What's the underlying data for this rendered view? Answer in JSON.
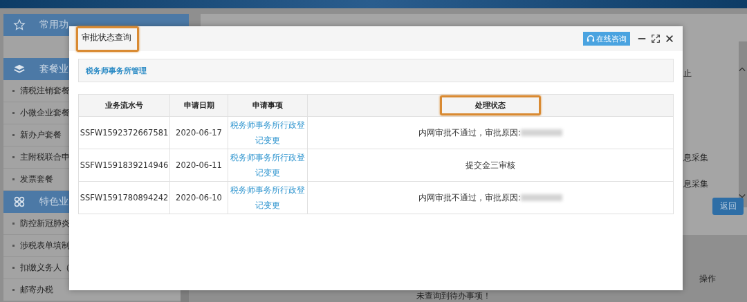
{
  "sidebar": {
    "sections": [
      {
        "title": "常用功"
      },
      {
        "title": "套餐业",
        "items": [
          "清税注销套餐",
          "小微企业套餐",
          "新办户套餐",
          "主附税联合申",
          "发票套餐"
        ]
      },
      {
        "title": "特色业",
        "items": [
          "防控新冠肺炎",
          "涉税表单填制",
          "扣缴义务人（",
          "邮寄办税"
        ]
      }
    ]
  },
  "background_panel": {
    "fragments": [
      "止",
      "息采集",
      "息采集"
    ],
    "back_button": "返回",
    "column_header": "操作",
    "empty_message": "未查询到待办事项！"
  },
  "dialog": {
    "title": "审批状态查询",
    "title_highlighted": true,
    "consult_button": "在线咨询",
    "breadcrumb": "税务师事务所管理",
    "table": {
      "columns": [
        {
          "label": "业务流水号",
          "highlighted": false
        },
        {
          "label": "申请日期",
          "highlighted": false
        },
        {
          "label": "申请事项",
          "highlighted": false
        },
        {
          "label": "处理状态",
          "highlighted": true
        }
      ],
      "rows": [
        {
          "serial": "SSFW1592372667581",
          "date": "2020-06-17",
          "matter": "税务师事务所行政登记变更",
          "status": "内网审批不通过，审批原因:",
          "redacted": true
        },
        {
          "serial": "SSFW1591839214946",
          "date": "2020-06-11",
          "matter": "税务师事务所行政登记变更",
          "status": "提交金三审核",
          "redacted": false
        },
        {
          "serial": "SSFW1591780894242",
          "date": "2020-06-10",
          "matter": "税务师事务所行政登记变更",
          "status": "内网审批不通过，审批原因:",
          "redacted": true
        }
      ]
    }
  }
}
